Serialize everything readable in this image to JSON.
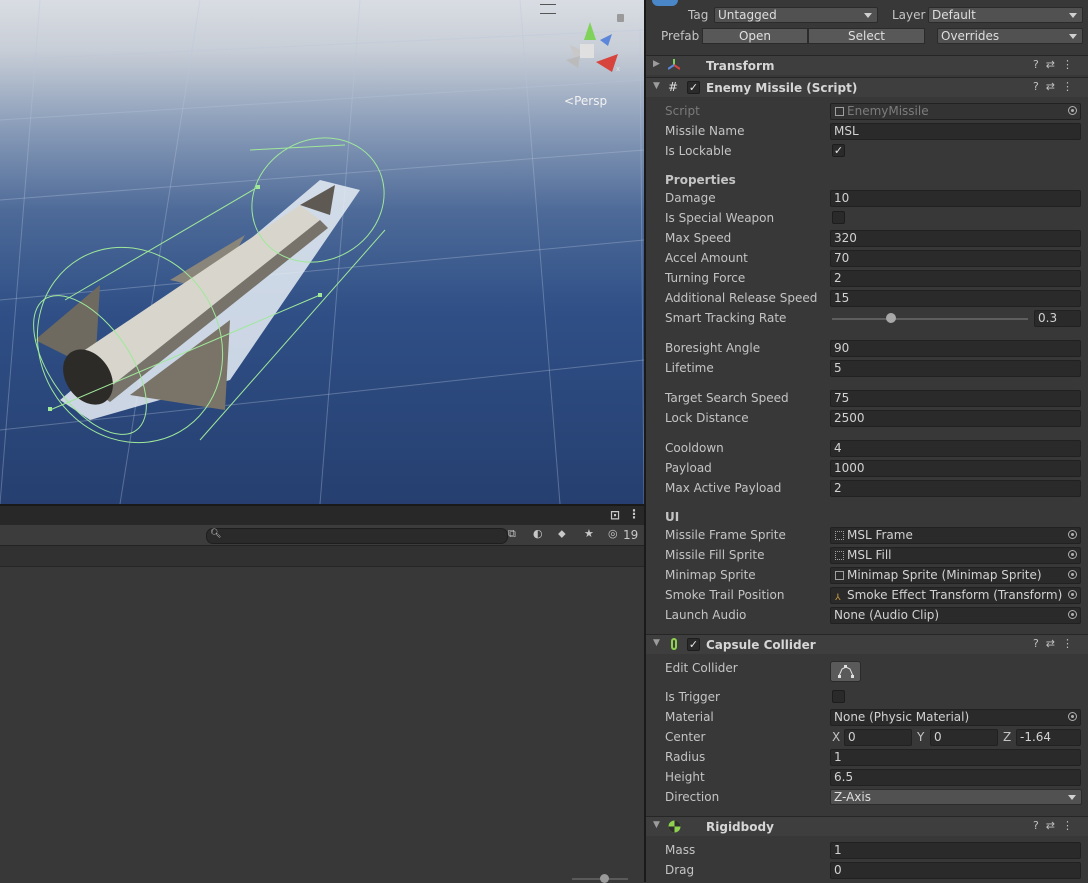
{
  "scene": {
    "projection_label": "Persp",
    "gizmo_axes": [
      "x",
      "y",
      "z"
    ]
  },
  "hierarchy": {
    "hidden_count": "19"
  },
  "inspector": {
    "header": {
      "tag_label": "Tag",
      "tag_value": "Untagged",
      "layer_label": "Layer",
      "layer_value": "Default",
      "prefab_label": "Prefab",
      "open_label": "Open",
      "select_label": "Select",
      "overrides_label": "Overrides"
    },
    "transform": {
      "title": "Transform"
    },
    "enemy_missile": {
      "title": "Enemy Missile (Script)",
      "enabled": true,
      "script_label": "Script",
      "script_value": "EnemyMissile",
      "missile_name_label": "Missile Name",
      "missile_name_value": "MSL",
      "is_lockable_label": "Is Lockable",
      "is_lockable": true,
      "properties_header": "Properties",
      "damage_label": "Damage",
      "damage_value": "10",
      "special_weapon_label": "Is Special Weapon",
      "special_weapon": false,
      "max_speed_label": "Max Speed",
      "max_speed_value": "320",
      "accel_label": "Accel Amount",
      "accel_value": "70",
      "turning_label": "Turning Force",
      "turning_value": "2",
      "release_label": "Additional Release Speed",
      "release_value": "15",
      "tracking_label": "Smart Tracking Rate",
      "tracking_value": "0.3",
      "tracking_fraction": 0.3,
      "boresight_label": "Boresight Angle",
      "boresight_value": "90",
      "lifetime_label": "Lifetime",
      "lifetime_value": "5",
      "search_speed_label": "Target Search Speed",
      "search_speed_value": "75",
      "lock_distance_label": "Lock Distance",
      "lock_distance_value": "2500",
      "cooldown_label": "Cooldown",
      "cooldown_value": "4",
      "payload_label": "Payload",
      "payload_value": "1000",
      "max_payload_label": "Max Active Payload",
      "max_payload_value": "2",
      "ui_header": "UI",
      "frame_sprite_label": "Missile Frame Sprite",
      "frame_sprite_value": "MSL Frame",
      "fill_sprite_label": "Missile Fill Sprite",
      "fill_sprite_value": "MSL Fill",
      "minimap_label": "Minimap Sprite",
      "minimap_value": "Minimap Sprite (Minimap Sprite)",
      "smoke_label": "Smoke Trail Position",
      "smoke_value": "Smoke Effect Transform (Transform)",
      "audio_label": "Launch Audio",
      "audio_value": "None (Audio Clip)"
    },
    "capsule_collider": {
      "title": "Capsule Collider",
      "enabled": true,
      "edit_label": "Edit Collider",
      "trigger_label": "Is Trigger",
      "is_trigger": false,
      "material_label": "Material",
      "material_value": "None (Physic Material)",
      "center_label": "Center",
      "center_x": "0",
      "center_y": "0",
      "center_z": "-1.64",
      "radius_label": "Radius",
      "radius_value": "1",
      "height_label": "Height",
      "height_value": "6.5",
      "direction_label": "Direction",
      "direction_value": "Z-Axis"
    },
    "rigidbody": {
      "title": "Rigidbody",
      "mass_label": "Mass",
      "mass_value": "1",
      "drag_label": "Drag",
      "drag_value": "0"
    }
  }
}
